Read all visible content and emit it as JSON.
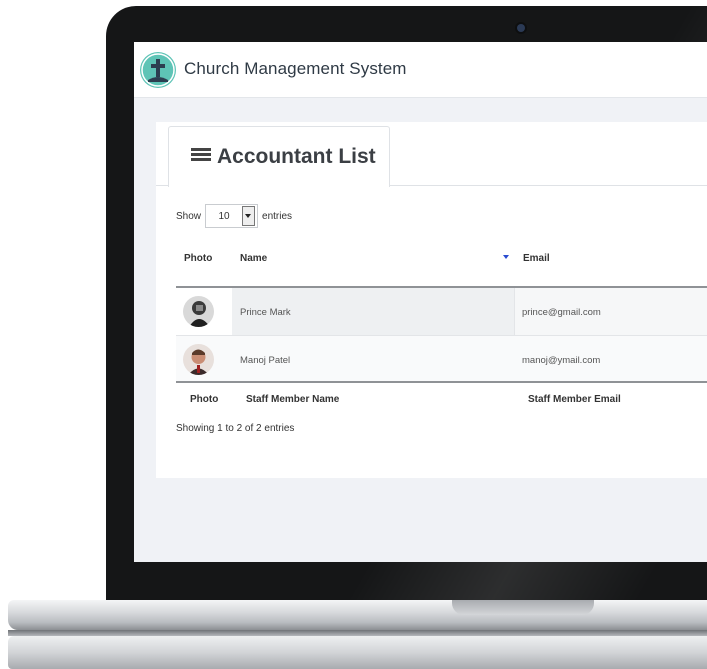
{
  "app": {
    "title": "Church Management System",
    "logo_icon": "cross-icon",
    "accent_color": "#5ec4b6"
  },
  "page": {
    "tab_title": "Accountant List",
    "tab_icon": "list-icon"
  },
  "length_control": {
    "show_label": "Show",
    "value": "10",
    "entries_label": "entries"
  },
  "table": {
    "header": {
      "photo": "Photo",
      "name": "Name",
      "email": "Email"
    },
    "rows": [
      {
        "name": "Prince Mark",
        "email": "prince@gmail.com",
        "avatar_icon": "user-photo"
      },
      {
        "name": "Manoj Patel",
        "email": "manoj@ymail.com",
        "avatar_icon": "user-photo"
      }
    ],
    "footer": {
      "photo": "Photo",
      "name": "Staff Member Name",
      "email": "Staff Member Email"
    }
  },
  "info_text": "Showing 1 to 2 of 2 entries"
}
